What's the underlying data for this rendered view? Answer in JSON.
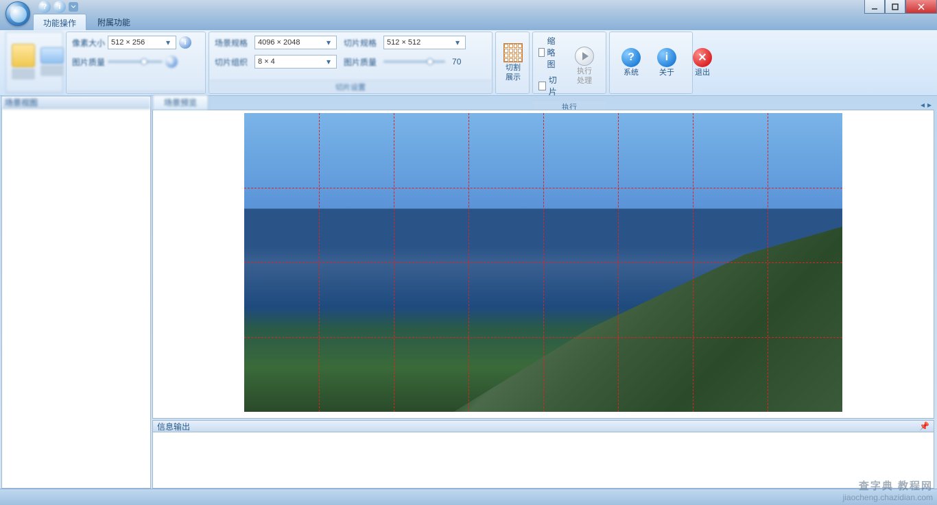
{
  "tabs": {
    "main": "功能操作",
    "secondary": "附属功能"
  },
  "ribbon": {
    "group1_label": "",
    "group2_label": "",
    "field_size_label": "像素大小",
    "field_size_value": "512 × 256",
    "field_scene_label": "场景规格",
    "field_scene_value": "4096 × 2048",
    "field_tile_label": "切片规格",
    "field_tile_value": "512 × 512",
    "field_quality_label": "图片质量",
    "field_tilegrid_label": "切片组织",
    "field_tilegrid_value": "8 × 4",
    "field_quality2_label": "图片质量",
    "quality_value": "70",
    "cut_display": "切割\n展示",
    "thumbnail": "缩略图",
    "slice": "切片",
    "execute_process": "执行\n处理",
    "execute": "执行",
    "system": "系统",
    "about": "关于",
    "exit": "退出"
  },
  "panels": {
    "left_header": "场景视图",
    "doc_tab": "场景预览",
    "output_header": "信息输出"
  },
  "watermark": {
    "title": "查字典 教程网",
    "url": "jiaocheng.chazidian.com"
  }
}
